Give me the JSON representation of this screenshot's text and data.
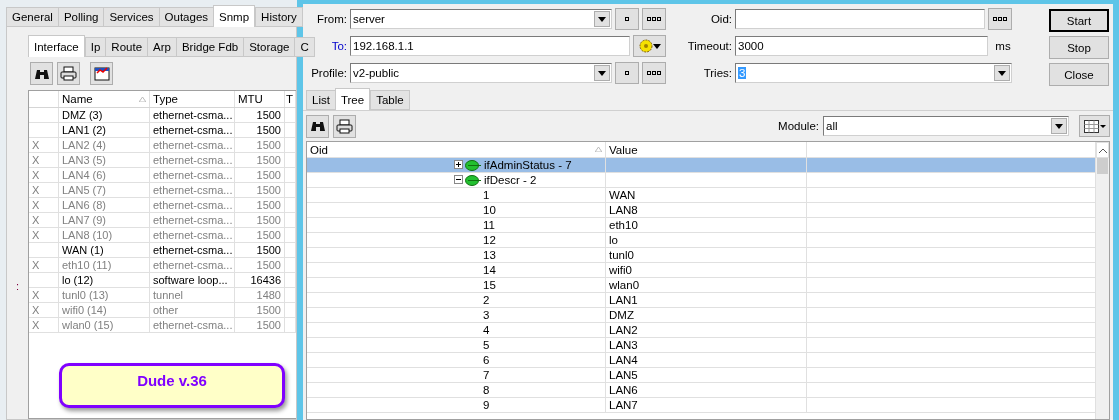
{
  "left_panel": {
    "outer_tabs": [
      {
        "label": "General",
        "selected": false
      },
      {
        "label": "Polling",
        "selected": false
      },
      {
        "label": "Services",
        "selected": false
      },
      {
        "label": "Outages",
        "selected": false
      },
      {
        "label": "Snmp",
        "selected": true
      },
      {
        "label": "History",
        "selected": false
      }
    ],
    "gutter_mark": ":",
    "inner_tabs": [
      {
        "label": "Interface",
        "selected": true
      },
      {
        "label": "Ip",
        "selected": false
      },
      {
        "label": "Route",
        "selected": false
      },
      {
        "label": "Arp",
        "selected": false
      },
      {
        "label": "Bridge Fdb",
        "selected": false
      },
      {
        "label": "Storage",
        "selected": false
      },
      {
        "label": "C",
        "selected": false
      }
    ],
    "table": {
      "columns": [
        "Name",
        "Type",
        "MTU",
        "T"
      ],
      "rows": [
        {
          "flag": "",
          "name": "DMZ (3)",
          "type": "ethernet-csma...",
          "mtu": "1500",
          "disabled": false
        },
        {
          "flag": "",
          "name": "LAN1 (2)",
          "type": "ethernet-csma...",
          "mtu": "1500",
          "disabled": false
        },
        {
          "flag": "X",
          "name": "LAN2 (4)",
          "type": "ethernet-csma...",
          "mtu": "1500",
          "disabled": true
        },
        {
          "flag": "X",
          "name": "LAN3 (5)",
          "type": "ethernet-csma...",
          "mtu": "1500",
          "disabled": true
        },
        {
          "flag": "X",
          "name": "LAN4 (6)",
          "type": "ethernet-csma...",
          "mtu": "1500",
          "disabled": true
        },
        {
          "flag": "X",
          "name": "LAN5 (7)",
          "type": "ethernet-csma...",
          "mtu": "1500",
          "disabled": true
        },
        {
          "flag": "X",
          "name": "LAN6 (8)",
          "type": "ethernet-csma...",
          "mtu": "1500",
          "disabled": true
        },
        {
          "flag": "X",
          "name": "LAN7 (9)",
          "type": "ethernet-csma...",
          "mtu": "1500",
          "disabled": true
        },
        {
          "flag": "X",
          "name": "LAN8 (10)",
          "type": "ethernet-csma...",
          "mtu": "1500",
          "disabled": true
        },
        {
          "flag": "",
          "name": "WAN (1)",
          "type": "ethernet-csma...",
          "mtu": "1500",
          "disabled": false
        },
        {
          "flag": "X",
          "name": "eth10 (11)",
          "type": "ethernet-csma...",
          "mtu": "1500",
          "disabled": true
        },
        {
          "flag": "",
          "name": "lo (12)",
          "type": "software loop...",
          "mtu": "16436",
          "disabled": false
        },
        {
          "flag": "X",
          "name": "tunl0 (13)",
          "type": "tunnel",
          "mtu": "1480",
          "disabled": true
        },
        {
          "flag": "X",
          "name": "wifi0 (14)",
          "type": "other",
          "mtu": "1500",
          "disabled": true
        },
        {
          "flag": "X",
          "name": "wlan0 (15)",
          "type": "ethernet-csma...",
          "mtu": "1500",
          "disabled": true
        }
      ]
    },
    "badge": "Dude v.36"
  },
  "snmp_window": {
    "from": {
      "label": "From:",
      "value": "server",
      "link": false
    },
    "to": {
      "label": "To:",
      "value": "192.168.1.1",
      "link": true
    },
    "profile": {
      "label": "Profile:",
      "value": "v2-public",
      "link": false
    },
    "oid": {
      "label": "Oid:"
    },
    "timeout": {
      "label": "Timeout:",
      "value": "3000",
      "unit": "ms"
    },
    "tries": {
      "label": "Tries:",
      "value": "3",
      "text_selected": true
    },
    "buttons": [
      {
        "label": "Start",
        "default": true
      },
      {
        "label": "Stop",
        "default": false
      },
      {
        "label": "Close",
        "default": false
      }
    ],
    "tabs": [
      {
        "label": "List",
        "selected": false
      },
      {
        "label": "Tree",
        "selected": true
      },
      {
        "label": "Table",
        "selected": false
      }
    ],
    "module": {
      "label": "Module:",
      "value": "all"
    },
    "tree": {
      "columns": [
        "Oid",
        "Value"
      ],
      "nodes": [
        {
          "label": "ifAdminStatus - 7",
          "expanded": false,
          "selected": true
        },
        {
          "label": "ifDescr - 2",
          "expanded": true,
          "selected": false,
          "children": [
            {
              "label": "1",
              "value": "WAN",
              "selected": false
            },
            {
              "label": "10",
              "value": "LAN8",
              "selected": false
            },
            {
              "label": "11",
              "value": "eth10",
              "selected": false
            },
            {
              "label": "12",
              "value": "lo",
              "selected": false
            },
            {
              "label": "13",
              "value": "tunl0",
              "selected": false
            },
            {
              "label": "14",
              "value": "wifi0",
              "selected": false
            },
            {
              "label": "15",
              "value": "wlan0",
              "selected": false
            },
            {
              "label": "2",
              "value": "LAN1",
              "selected": false
            },
            {
              "label": "3",
              "value": "DMZ",
              "selected": false
            },
            {
              "label": "4",
              "value": "LAN2",
              "selected": false
            },
            {
              "label": "5",
              "value": "LAN3",
              "selected": false
            },
            {
              "label": "6",
              "value": "LAN4",
              "selected": false
            },
            {
              "label": "7",
              "value": "LAN5",
              "selected": false
            },
            {
              "label": "8",
              "value": "LAN6",
              "selected": false
            },
            {
              "label": "9",
              "value": "LAN7",
              "selected": false
            }
          ]
        }
      ]
    }
  }
}
